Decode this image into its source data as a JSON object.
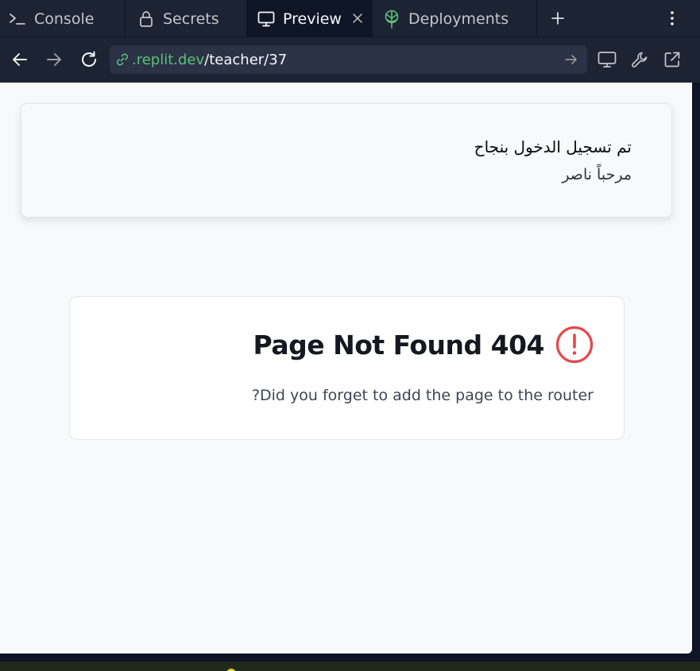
{
  "tabs": [
    {
      "label": "Console",
      "icon": "terminal-icon"
    },
    {
      "label": "Secrets",
      "icon": "lock-icon"
    },
    {
      "label": "Preview",
      "icon": "monitor-icon",
      "active": true
    },
    {
      "label": "Deployments",
      "icon": "deployments-icon"
    }
  ],
  "toolbar": {
    "url_domain": ".replit.dev",
    "url_path": "/teacher/37"
  },
  "toast": {
    "title": "تم تسجيل الدخول بنجاح",
    "message": "مرحباً ناصر"
  },
  "error_card": {
    "title": "Page Not Found 404",
    "message": "?Did you forget to add the page to the router"
  },
  "colors": {
    "chrome_bg": "#1c2333",
    "url_domain": "#5bc176",
    "alert_red": "#e5484d",
    "page_bg": "#f8f9fb"
  }
}
